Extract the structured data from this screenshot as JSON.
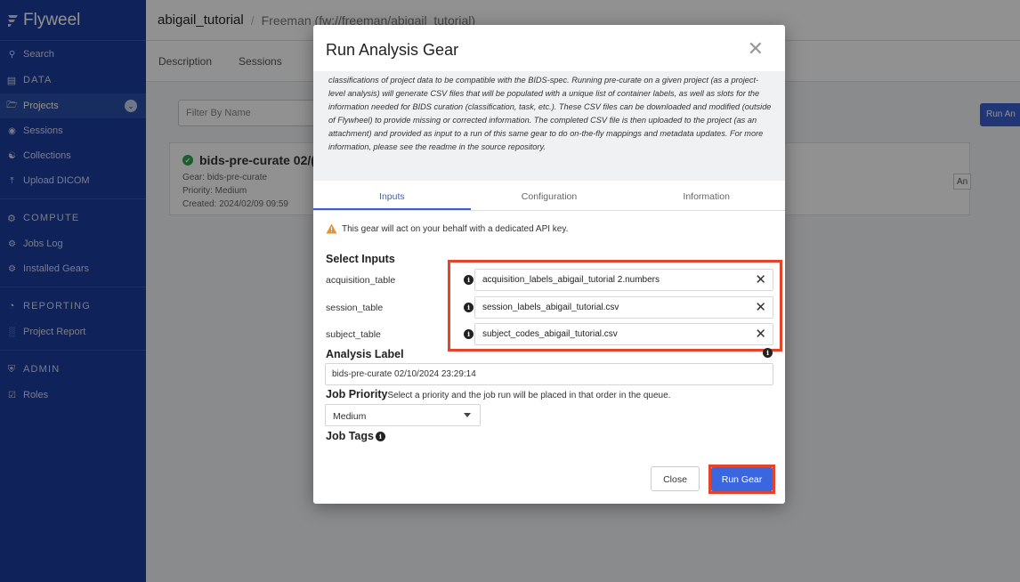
{
  "app": {
    "brand": "Flyweel"
  },
  "sidebar": {
    "items": [
      {
        "label": "Search",
        "icon": "search-icon"
      },
      {
        "label": "DATA",
        "icon": "database-icon"
      },
      {
        "label": "Projects",
        "icon": "folder-icon"
      },
      {
        "label": "Sessions",
        "icon": "sessions-icon"
      },
      {
        "label": "Collections",
        "icon": "collections-icon"
      },
      {
        "label": "Upload DICOM",
        "icon": "upload-icon"
      },
      {
        "label": "COMPUTE",
        "icon": "gear-icon"
      },
      {
        "label": "Jobs Log",
        "icon": "gears-icon"
      },
      {
        "label": "Installed Gears",
        "icon": "gear-icon"
      },
      {
        "label": "REPORTING",
        "icon": "pie-chart-icon"
      },
      {
        "label": "Project Report",
        "icon": "bar-chart-icon"
      },
      {
        "label": "ADMIN",
        "icon": "shield-icon"
      },
      {
        "label": "Roles",
        "icon": "check-square-icon"
      }
    ]
  },
  "header": {
    "project_title": "abigail_tutorial",
    "project_path": "Freeman (fw://freeman/abigail_tutorial)"
  },
  "tabs": [
    "Description",
    "Sessions"
  ],
  "filter": {
    "placeholder": "Filter By Name"
  },
  "run_analysis_button": "Run An",
  "card": {
    "title": "bids-pre-curate 02/(",
    "gear": "Gear: bids-pre-curate",
    "priority": "Priority: Medium",
    "created": "Created: 2024/02/09 09:59",
    "side_button": "An"
  },
  "modal": {
    "title": "Run Analysis Gear",
    "description": "classifications of project data to be compatible with the BIDS-spec. Running pre-curate on a given project (as a project-level analysis) will generate CSV files that will be populated with a unique list of container labels, as well as slots for the information needed for BIDS curation (classification, task, etc.). These CSV files can be downloaded and modified (outside of Flywheel) to provide missing or corrected information. The completed CSV file is then uploaded to the project (as an attachment) and provided as input to a run of this same gear to do on-the-fly mappings and metadata updates. For more information, please see the readme in the source repository.",
    "tabs": [
      "Inputs",
      "Configuration",
      "Information"
    ],
    "warning": "This gear will act on your behalf with a dedicated API key.",
    "select_inputs_label": "Select Inputs",
    "inputs": [
      {
        "label": "acquisition_table",
        "value": "acquisition_labels_abigail_tutorial 2.numbers"
      },
      {
        "label": "session_table",
        "value": "session_labels_abigail_tutorial.csv"
      },
      {
        "label": "subject_table",
        "value": "subject_codes_abigail_tutorial.csv"
      }
    ],
    "analysis_label_title": "Analysis Label",
    "analysis_label_value": "bids-pre-curate 02/10/2024 23:29:14",
    "job_priority_title": "Job Priority",
    "job_priority_hint": "Select a priority and the job run will be placed in that order in the queue.",
    "job_priority_value": "Medium",
    "job_tags_title": "Job Tags",
    "close_button": "Close",
    "run_button": "Run Gear"
  },
  "colors": {
    "sidebar": "#1b3d9e",
    "accent": "#3a66e0",
    "highlight": "#e2452a",
    "success": "#2fa84f"
  }
}
